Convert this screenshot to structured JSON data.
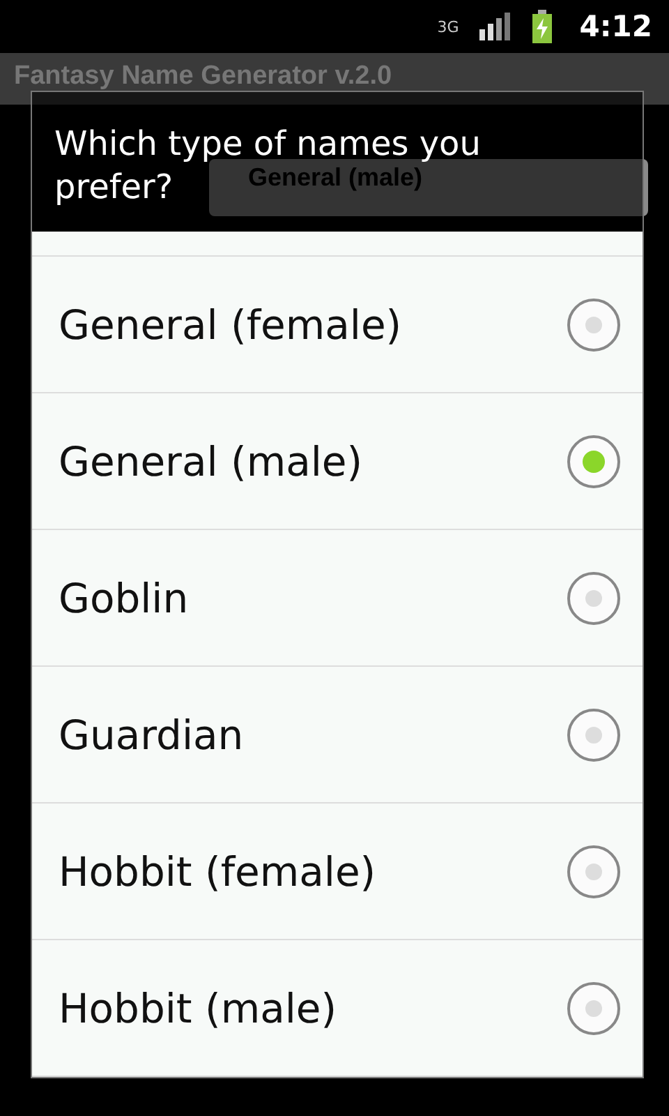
{
  "status_bar": {
    "time": "4:12",
    "network": "3G"
  },
  "app": {
    "title": "Fantasy Name Generator v.2.0",
    "selected_button": "General (male)"
  },
  "dialog": {
    "title": "Which type of names you prefer?",
    "options": [
      {
        "label": "General (female)",
        "selected": false
      },
      {
        "label": "General (male)",
        "selected": true
      },
      {
        "label": "Goblin",
        "selected": false
      },
      {
        "label": "Guardian",
        "selected": false
      },
      {
        "label": "Hobbit (female)",
        "selected": false
      },
      {
        "label": "Hobbit (male)",
        "selected": false
      }
    ]
  }
}
